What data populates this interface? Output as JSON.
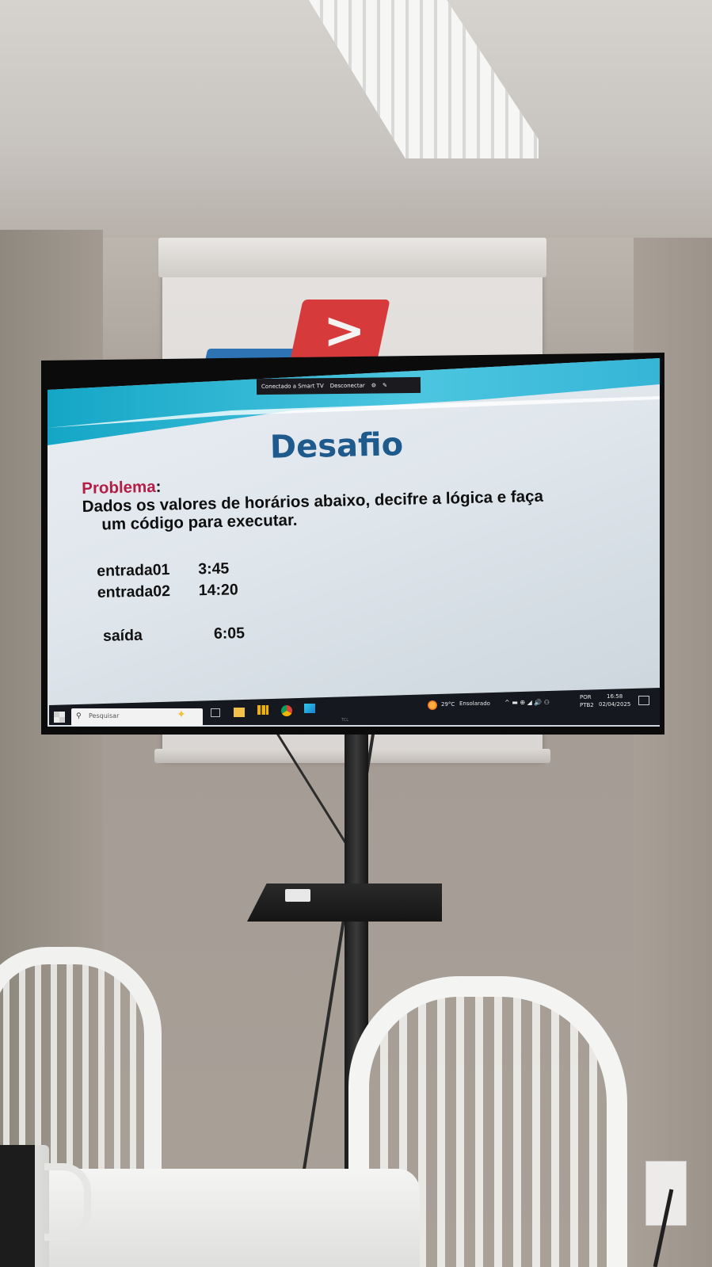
{
  "cast_bar": {
    "status": "Conectado a Smart TV",
    "disconnect": "Desconectar"
  },
  "slide": {
    "title": "Desafio",
    "problem_label": "Problema",
    "problem_colon": ":",
    "problem_line1": "Dados os valores de horários abaixo, decifre a lógica e faça",
    "problem_line2": "um código para executar.",
    "values": [
      {
        "label": "entrada01",
        "value": "3:45"
      },
      {
        "label": "entrada02",
        "value": "14:20"
      },
      {
        "label": "saída",
        "value": "6:05"
      }
    ]
  },
  "taskbar": {
    "search_placeholder": "Pesquisar",
    "weather_temp": "29°C",
    "weather_desc": "Ensolarado",
    "lang_top": "POR",
    "lang_bottom": "PTB2",
    "time": "16:58",
    "date": "02/04/2025"
  },
  "colors": {
    "title": "#1f5a8c",
    "problem_label": "#b31d46",
    "wave": "#14a6c6",
    "taskbar": "#15181e"
  }
}
